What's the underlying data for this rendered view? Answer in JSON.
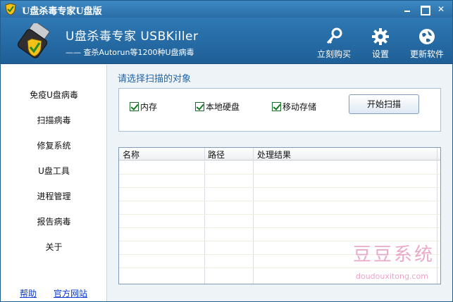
{
  "window": {
    "title": "U盘杀毒专家U盘版"
  },
  "header": {
    "app_name": "U盘杀毒专家   USBKiller",
    "slogan": "—— 查杀Autorun等1200种U盘病毒",
    "buttons": [
      {
        "label": "立刻购买",
        "icon": "key-icon"
      },
      {
        "label": "设置",
        "icon": "gear-icon"
      },
      {
        "label": "更新软件",
        "icon": "globe-update-icon"
      }
    ]
  },
  "sidebar": {
    "items": [
      {
        "label": "免疫U盘病毒"
      },
      {
        "label": "扫描病毒"
      },
      {
        "label": "修复系统"
      },
      {
        "label": "U盘工具"
      },
      {
        "label": "进程管理"
      },
      {
        "label": "报告病毒"
      },
      {
        "label": "关于"
      }
    ],
    "links": {
      "help": "帮助",
      "website": "官方网站"
    }
  },
  "main": {
    "section_title": "请选择扫描的对象",
    "options": [
      {
        "label": "内存",
        "checked": true
      },
      {
        "label": "本地硬盘",
        "checked": true
      },
      {
        "label": "移动存储",
        "checked": true
      }
    ],
    "scan_button": "开始扫描",
    "table": {
      "columns": [
        "名称",
        "路径",
        "处理结果"
      ],
      "rows": []
    }
  },
  "watermark": {
    "cn": "豆豆系统",
    "en": "doudouxitong.com"
  },
  "colors": {
    "header": "#2b6ea6",
    "accent_title": "#1d63a8",
    "link": "#0b3bd1",
    "check": "#137a1e"
  }
}
